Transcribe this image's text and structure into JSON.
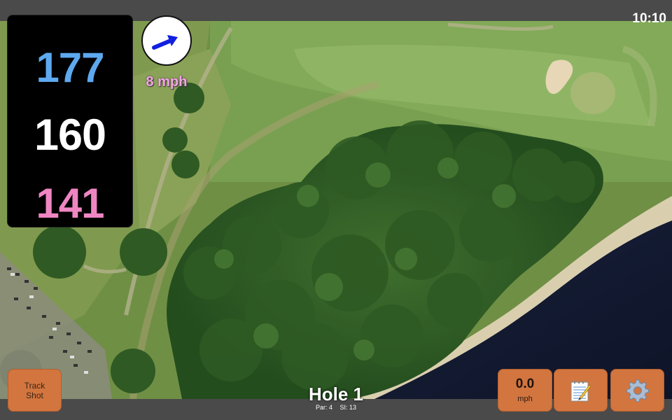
{
  "status_bar": {
    "time": "10:10"
  },
  "distances": {
    "back": "177",
    "center": "160",
    "front": "141"
  },
  "wind": {
    "speed": "8 mph",
    "icon": "wind-arrow-icon"
  },
  "buttons": {
    "track_shot": "Track\nShot",
    "speed_value": "0.0",
    "speed_unit": "mph",
    "notes_icon": "notepad-icon",
    "settings_icon": "gear-icon"
  },
  "hole": {
    "title": "Hole 1",
    "par": "Par: 4",
    "si": "SI: 13"
  },
  "colors": {
    "back": "#5da9ef",
    "center": "#ffffff",
    "front": "#ef86c3",
    "wind_text": "#f1a7e2",
    "button": "#d2753f",
    "bar": "#4a4a4a"
  }
}
